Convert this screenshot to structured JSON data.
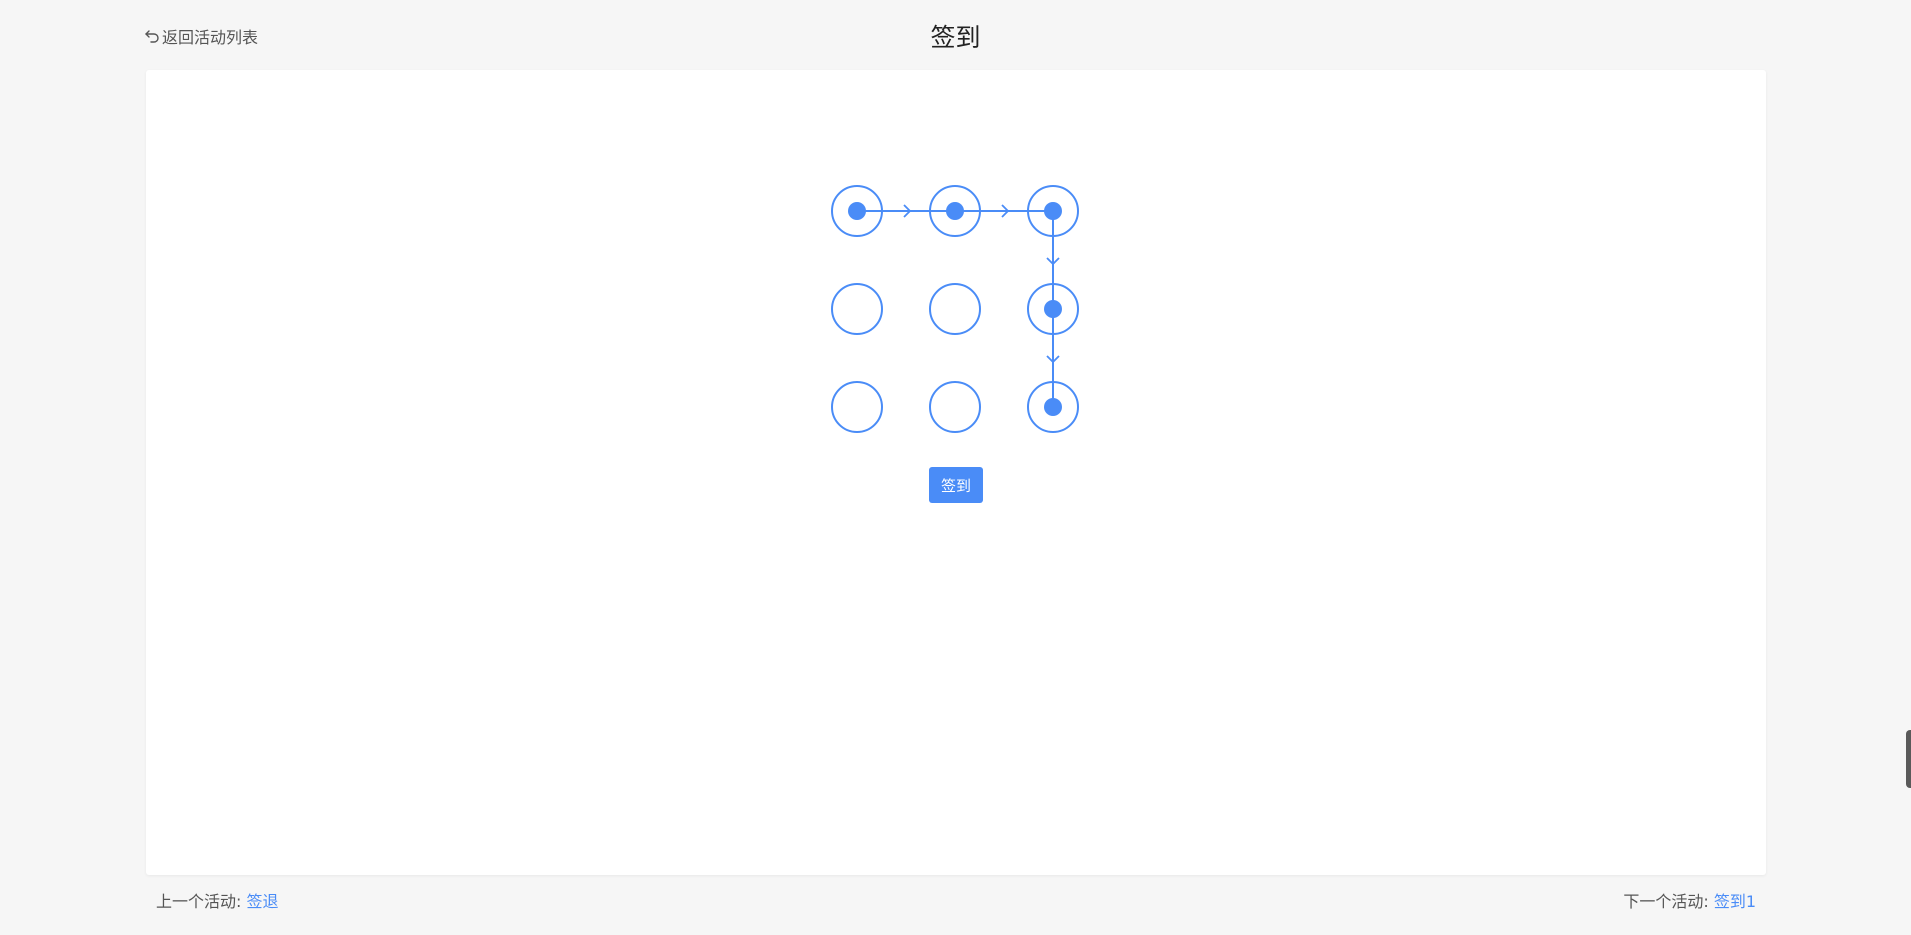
{
  "header": {
    "back_label": "返回活动列表",
    "title": "签到"
  },
  "pattern": {
    "grid": [
      [
        true,
        true,
        true
      ],
      [
        false,
        false,
        true
      ],
      [
        false,
        false,
        true
      ]
    ],
    "path": [
      [
        0,
        0
      ],
      [
        0,
        1
      ],
      [
        0,
        2
      ],
      [
        1,
        2
      ],
      [
        2,
        2
      ]
    ],
    "color": "#4a8cf7"
  },
  "main": {
    "sign_button_label": "签到"
  },
  "footer": {
    "prev_label": "上一个活动: ",
    "prev_link": "签退",
    "next_label": "下一个活动: ",
    "next_link": "签到1"
  }
}
